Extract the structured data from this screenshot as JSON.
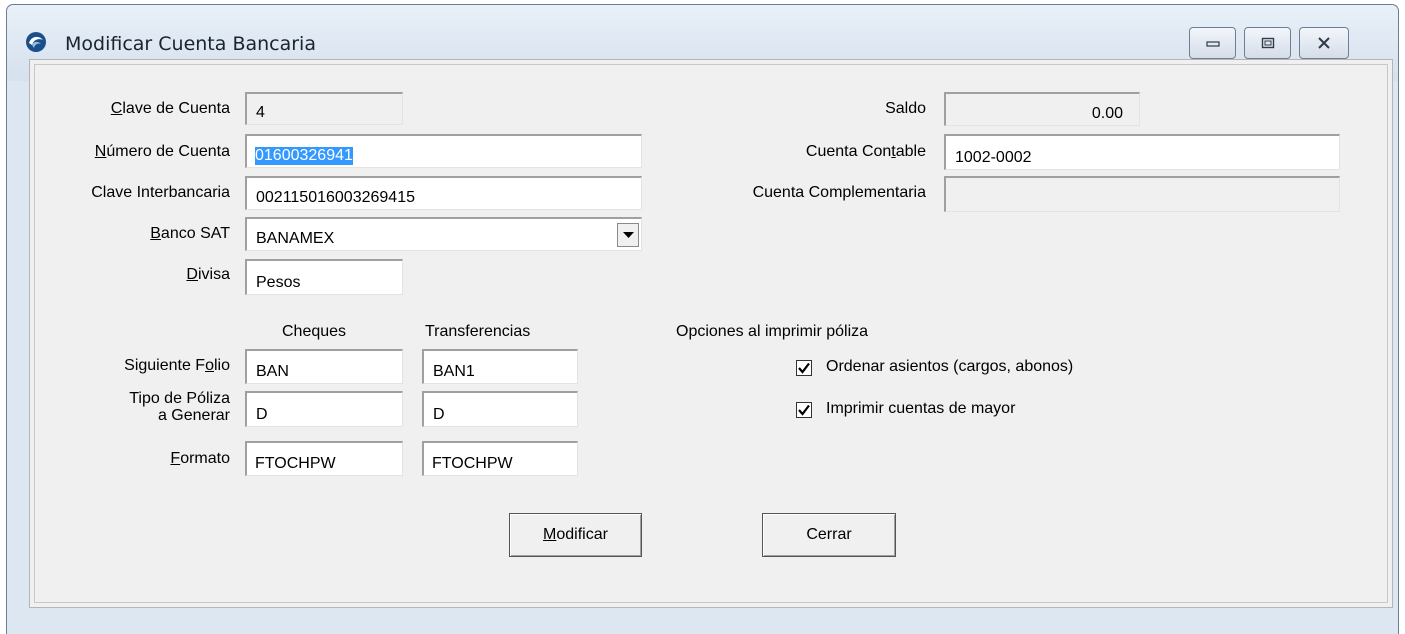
{
  "window": {
    "title": "Modificar Cuenta Bancaria",
    "icon": "app-logo-icon",
    "controls": [
      "minimize-icon",
      "maximize-icon",
      "close-icon"
    ]
  },
  "left": {
    "clave_cuenta": {
      "label_u": "C",
      "label_rest": "lave de Cuenta",
      "value": "4"
    },
    "numero_cuenta": {
      "label_u": "N",
      "label_rest": "úmero de Cuenta",
      "value": "01600326941"
    },
    "clave_interbancaria": {
      "label": "Clave Interbancaria",
      "value": "002115016003269415"
    },
    "banco_sat": {
      "label_u": "B",
      "label_rest": "anco SAT",
      "value": "BANAMEX"
    },
    "divisa": {
      "label_u": "D",
      "label_rest": "ivisa",
      "value": "Pesos"
    }
  },
  "right": {
    "saldo": {
      "label": "Saldo",
      "value": "0.00"
    },
    "cuenta_contable": {
      "label_pre": "Cuenta Con",
      "label_u": "t",
      "label_post": "able",
      "value": "1002-0002"
    },
    "cuenta_complementaria": {
      "label": "Cuenta Complementaria",
      "value": ""
    }
  },
  "folios": {
    "col_cheques": "Cheques",
    "col_transferencias": "Transferencias",
    "siguiente_folio": {
      "label_pre": "Siguiente F",
      "label_u": "o",
      "label_post": "lio",
      "cheques": "BAN",
      "transferencias": "BAN1"
    },
    "tipo_poliza": {
      "label_line1": "Tipo de Póliza",
      "label_line2": "a Generar",
      "cheques": "D",
      "transferencias": "D"
    },
    "formato": {
      "label_u": "F",
      "label_rest": "ormato",
      "cheques": "FTOCHPW",
      "transferencias": "FTOCHPW"
    }
  },
  "opciones": {
    "title": "Opciones al imprimir póliza",
    "ordenar": {
      "label": "Ordenar asientos (cargos, abonos)",
      "checked": true
    },
    "imprimir": {
      "label": "Imprimir cuentas de mayor",
      "checked": true
    }
  },
  "buttons": {
    "modificar_u": "M",
    "modificar_rest": "odificar",
    "cerrar": "Cerrar"
  }
}
